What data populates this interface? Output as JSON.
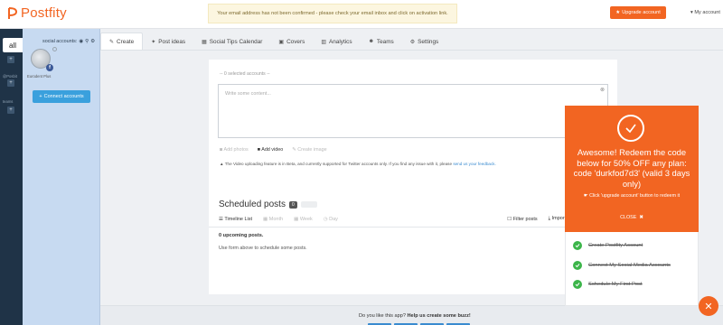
{
  "brand": {
    "name": "Postfity",
    "color": "#f26522"
  },
  "header": {
    "notice": "Your email address has not been confirmed - please check your email inbox and click on activation link.",
    "upgrade_label": "Upgrade account",
    "account_label": "My account"
  },
  "rail": {
    "all_label": "all",
    "group1_label": "@Posbit",
    "group2_label": "teams"
  },
  "accounts": {
    "header": "social accounts:",
    "account_name": "Eurodent Plus",
    "connect_label": "Connect accounts"
  },
  "tabs": [
    {
      "label": "Create",
      "icon": "pencil-icon"
    },
    {
      "label": "Post ideas",
      "icon": "lightbulb-icon"
    },
    {
      "label": "Social Tips Calendar",
      "icon": "calendar-icon"
    },
    {
      "label": "Covers",
      "icon": "image-icon"
    },
    {
      "label": "Analytics",
      "icon": "bar-chart-icon"
    },
    {
      "label": "Teams",
      "icon": "users-icon"
    },
    {
      "label": "Settings",
      "icon": "gears-icon"
    }
  ],
  "composer": {
    "selected_accounts": "-- 0 selected accounts --",
    "placeholder": "Write some content...",
    "add_photos": "Add photos",
    "add_video": "Add video",
    "create_image": "Create image",
    "beta_note": "The Video uploading feature is in Beta, and currently supported for Twitter accounts only. If you find any issue with it, please",
    "beta_link": "send us your feedback."
  },
  "schedule": {
    "title": "Scheduled posts",
    "count": "0",
    "views": {
      "timeline": "Timeline List",
      "month": "Month",
      "week": "Week",
      "day": "Day"
    },
    "filter_label": "Filter posts",
    "import_label": "Import posts from file",
    "upcoming": "0 upcoming posts.",
    "hint": "Use form above to schedule some posts."
  },
  "footer": {
    "question": "Do you like this app?",
    "cta": "Help us create some buzz!"
  },
  "promo": {
    "headline": "Awesome! Redeem the code below for 50% OFF any plan: code 'durkfod7d3' (valid 3 days only)",
    "instruction": "Click 'upgrade account' button to redeem it",
    "close_label": "CLOSE"
  },
  "checklist": [
    "Create Postfity Account",
    "Connect My Social Media Accounts",
    "Schedule My First Post"
  ],
  "colors": {
    "accent": "#f26522",
    "link": "#3a8bd0",
    "rail": "#1f3347",
    "accounts_panel": "#c7daf1",
    "done": "#3cb54a"
  }
}
